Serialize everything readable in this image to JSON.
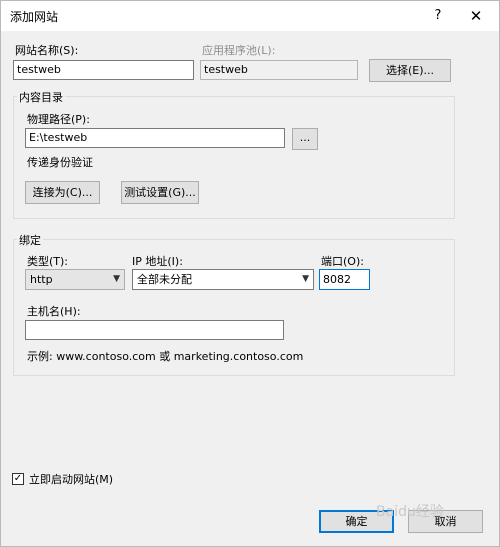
{
  "window": {
    "title": "添加网站",
    "help": "?",
    "close": "✕"
  },
  "site_name": {
    "label": "网站名称(S):",
    "value": "testweb"
  },
  "app_pool": {
    "label": "应用程序池(L):",
    "value": "testweb",
    "select_button": "选择(E)..."
  },
  "content_dir": {
    "group_title": "内容目录",
    "physical_path_label": "物理路径(P):",
    "physical_path_value": "E:\\testweb",
    "browse_button": "...",
    "passthrough_label": "传递身份验证",
    "connect_as_button": "连接为(C)...",
    "test_settings_button": "测试设置(G)..."
  },
  "binding": {
    "group_title": "绑定",
    "type_label": "类型(T):",
    "type_value": "http",
    "ip_label": "IP 地址(I):",
    "ip_value": "全部未分配",
    "port_label": "端口(O):",
    "port_value": "8082",
    "host_label": "主机名(H):",
    "host_value": "",
    "example": "示例: www.contoso.com 或 marketing.contoso.com"
  },
  "start_now": {
    "label": "立即启动网站(M)",
    "checked": true
  },
  "footer": {
    "ok_button": "确定",
    "cancel_button": "取消"
  },
  "watermark": "Baidu经验"
}
